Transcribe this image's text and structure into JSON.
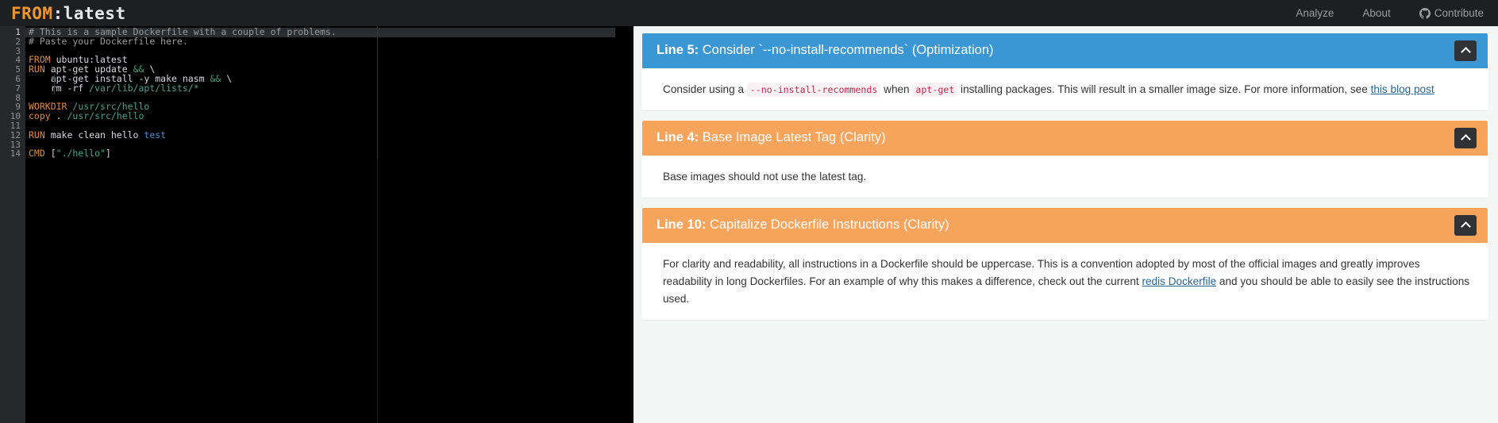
{
  "navbar": {
    "brand": {
      "from": "FROM",
      "colon": ":",
      "latest": "latest"
    },
    "links": [
      {
        "label": "Analyze",
        "icon": null
      },
      {
        "label": "About",
        "icon": null
      },
      {
        "label": "Contribute",
        "icon": "github-icon"
      }
    ]
  },
  "editor": {
    "language": "dockerfile",
    "active_line": 1,
    "lines": [
      {
        "n": 1,
        "tokens": [
          {
            "t": "# This is a sample Dockerfile with a couple of problems.",
            "c": "comment"
          }
        ]
      },
      {
        "n": 2,
        "tokens": [
          {
            "t": "# Paste your Dockerfile here.",
            "c": "comment"
          }
        ]
      },
      {
        "n": 3,
        "tokens": []
      },
      {
        "n": 4,
        "tokens": [
          {
            "t": "FROM",
            "c": "kw"
          },
          {
            "t": " ubuntu:latest",
            "c": "plain"
          }
        ]
      },
      {
        "n": 5,
        "tokens": [
          {
            "t": "RUN",
            "c": "kw"
          },
          {
            "t": " apt-get update ",
            "c": "plain"
          },
          {
            "t": "&&",
            "c": "op"
          },
          {
            "t": " \\",
            "c": "plain"
          }
        ]
      },
      {
        "n": 6,
        "tokens": [
          {
            "t": "    apt-get install -y make nasm ",
            "c": "plain"
          },
          {
            "t": "&&",
            "c": "op"
          },
          {
            "t": " \\",
            "c": "plain"
          }
        ]
      },
      {
        "n": 7,
        "tokens": [
          {
            "t": "    rm -rf ",
            "c": "plain"
          },
          {
            "t": "/var/lib/apt/lists/*",
            "c": "str"
          }
        ]
      },
      {
        "n": 8,
        "tokens": []
      },
      {
        "n": 9,
        "tokens": [
          {
            "t": "WORKDIR",
            "c": "kw"
          },
          {
            "t": " ",
            "c": "plain"
          },
          {
            "t": "/usr/src/hello",
            "c": "str"
          }
        ]
      },
      {
        "n": 10,
        "tokens": [
          {
            "t": "copy",
            "c": "kw"
          },
          {
            "t": " . ",
            "c": "plain"
          },
          {
            "t": "/usr/src/hello",
            "c": "str"
          }
        ]
      },
      {
        "n": 11,
        "tokens": []
      },
      {
        "n": 12,
        "tokens": [
          {
            "t": "RUN",
            "c": "kw"
          },
          {
            "t": " make clean hello ",
            "c": "plain"
          },
          {
            "t": "test",
            "c": "blue"
          }
        ]
      },
      {
        "n": 13,
        "tokens": []
      },
      {
        "n": 14,
        "tokens": [
          {
            "t": "CMD",
            "c": "kw"
          },
          {
            "t": " [",
            "c": "plain"
          },
          {
            "t": "\"./hello\"",
            "c": "str"
          },
          {
            "t": "]",
            "c": "plain"
          }
        ]
      }
    ]
  },
  "results": {
    "collapse_icon": "chevron-up-icon",
    "cards": [
      {
        "id": "card-line-5",
        "severity_color": "#3b97d3",
        "header_style": "blue",
        "line_label": "Line 5:",
        "title": "Consider `--no-install-recommends` (Optimization)",
        "category": "Optimization",
        "body": [
          {
            "type": "text",
            "value": "Consider using a "
          },
          {
            "type": "code",
            "value": "--no-install-recommends"
          },
          {
            "type": "text",
            "value": " when "
          },
          {
            "type": "code",
            "value": "apt-get"
          },
          {
            "type": "text",
            "value": " installing packages. This will result in a smaller image size. For more information, see "
          },
          {
            "type": "link",
            "value": "this blog post"
          }
        ]
      },
      {
        "id": "card-line-4",
        "severity_color": "#f6a35c",
        "header_style": "orange",
        "line_label": "Line 4:",
        "title": "Base Image Latest Tag (Clarity)",
        "category": "Clarity",
        "body": [
          {
            "type": "text",
            "value": "Base images should not use the latest tag."
          }
        ]
      },
      {
        "id": "card-line-10",
        "severity_color": "#f6a35c",
        "header_style": "orange",
        "line_label": "Line 10:",
        "title": "Capitalize Dockerfile Instructions (Clarity)",
        "category": "Clarity",
        "body": [
          {
            "type": "text",
            "value": "For clarity and readability, all instructions in a Dockerfile should be uppercase. This is a convention adopted by most of the official images and greatly improves readability in long Dockerfiles. For an example of why this makes a difference, check out the current "
          },
          {
            "type": "link",
            "value": "redis Dockerfile"
          },
          {
            "type": "text",
            "value": " and you should be able to easily see the instructions used."
          }
        ]
      }
    ]
  }
}
